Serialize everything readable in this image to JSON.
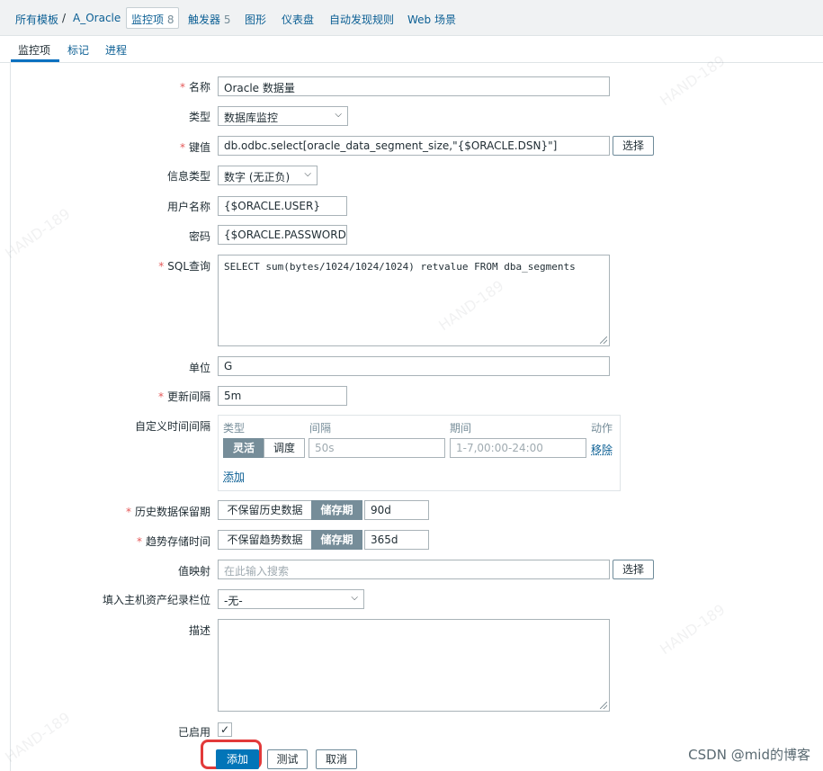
{
  "breadcrumb": {
    "all_templates": "所有模板",
    "sep": "/",
    "template": "A_Oracle",
    "items_label": "监控项",
    "items_count": "8",
    "triggers_label": "触发器",
    "triggers_count": "5",
    "graphs": "图形",
    "dashboards": "仪表盘",
    "discovery": "自动发现规则",
    "web": "Web 场景"
  },
  "tabs": {
    "item": "监控项",
    "tags": "标记",
    "preprocessing": "进程"
  },
  "form": {
    "name_label": "名称",
    "name_value": "Oracle 数据量",
    "type_label": "类型",
    "type_value": "数据库监控",
    "key_label": "键值",
    "key_value": "db.odbc.select[oracle_data_segment_size,\"{$ORACLE.DSN}\"]",
    "key_select": "选择",
    "info_type_label": "信息类型",
    "info_type_value": "数字 (无正负)",
    "user_label": "用户名称",
    "user_value": "{$ORACLE.USER}",
    "password_label": "密码",
    "password_value": "{$ORACLE.PASSWORD}",
    "sql_label": "SQL查询",
    "sql_value": "SELECT sum(bytes/1024/1024/1024) retvalue FROM dba_segments",
    "units_label": "单位",
    "units_value": "G",
    "interval_label": "更新间隔",
    "interval_value": "5m",
    "custom_label": "自定义时间间隔",
    "custom": {
      "col_type": "类型",
      "col_interval": "间隔",
      "col_period": "期间",
      "col_action": "动作",
      "flexible": "灵活",
      "scheduling": "调度",
      "interval_placeholder": "50s",
      "period_placeholder": "1-7,00:00-24:00",
      "remove": "移除",
      "add": "添加"
    },
    "history_label": "历史数据保留期",
    "history_no_keep": "不保留历史数据",
    "history_keep": "储存期",
    "history_value": "90d",
    "trends_label": "趋势存储时间",
    "trends_no_keep": "不保留趋势数据",
    "trends_keep": "储存期",
    "trends_value": "365d",
    "valuemap_label": "值映射",
    "valuemap_placeholder": "在此输入搜索",
    "valuemap_select": "选择",
    "inventory_label": "填入主机资产纪录栏位",
    "inventory_value": "-无-",
    "description_label": "描述",
    "description_value": "",
    "enabled_label": "已启用",
    "enabled_mark": "✓"
  },
  "buttons": {
    "add": "添加",
    "test": "测试",
    "cancel": "取消"
  },
  "watermark": "HAND-189",
  "credit": "CSDN @mid的博客",
  "colors": {
    "link": "#0b5f94",
    "primary": "#0275b8",
    "required": "#e45959",
    "highlight": "#e23a3a",
    "segment_on": "#768d99"
  }
}
